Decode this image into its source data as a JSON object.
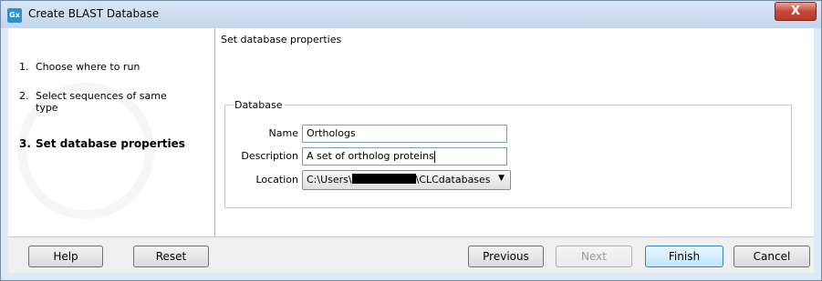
{
  "window": {
    "title": "Create BLAST Database",
    "app_icon_text": "Gx",
    "close_label": "X"
  },
  "steps": [
    {
      "num": "1.",
      "label": "Choose where to run"
    },
    {
      "num": "2.",
      "label": "Select sequences of same",
      "label2": "type"
    },
    {
      "num": "3.",
      "label": "Set database properties"
    }
  ],
  "main": {
    "section_title": "Set database properties",
    "database": {
      "legend": "Database",
      "name_label": "Name",
      "name_value": "Orthologs",
      "description_label": "Description",
      "description_value": "A set of ortholog proteins",
      "location_label": "Location",
      "location_prefix": "C:\\Users\\",
      "location_suffix": "\\CLCdatabases"
    }
  },
  "buttons": {
    "help": "Help",
    "reset": "Reset",
    "previous": "Previous",
    "next": "Next",
    "finish": "Finish",
    "cancel": "Cancel"
  }
}
